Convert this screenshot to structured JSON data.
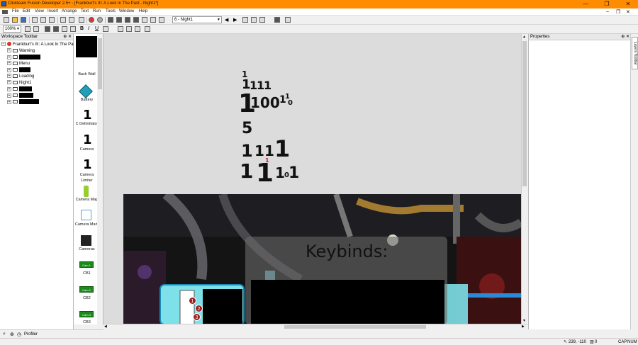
{
  "window": {
    "title": "Clickteam Fusion Developer 2.5+ - [Frankburt's III: A Look In The Past - Night1*]",
    "minimize": "—",
    "maximize": "❐",
    "close": "✕"
  },
  "menu": [
    "File",
    "Edit",
    "View",
    "Insert",
    "Arrange",
    "Text",
    "Run",
    "Tools",
    "Window",
    "Help"
  ],
  "toolbar": {
    "frame_select": "6 - Night1",
    "zoom": "100%"
  },
  "workspace": {
    "header": "Workspace Toolbar",
    "tree": [
      {
        "label": "Frankburt's III: A Look In The Past",
        "level": 0
      },
      {
        "label": "Warning",
        "level": 1
      },
      {
        "label": "",
        "level": 1,
        "redacted": true
      },
      {
        "label": "Menu",
        "level": 1
      },
      {
        "label": "",
        "level": 1,
        "redacted": true
      },
      {
        "label": "Loading",
        "level": 1
      },
      {
        "label": "Night1",
        "level": 1
      },
      {
        "label": "",
        "level": 1,
        "redacted": true
      },
      {
        "label": "",
        "level": 1,
        "redacted": true
      },
      {
        "label": "",
        "level": 1,
        "redacted": true
      }
    ]
  },
  "objects": [
    {
      "label": "Back Wall",
      "icon": "black-square-icon"
    },
    {
      "label": "Battery",
      "icon": "diamond-icon"
    },
    {
      "label": "C Delimitator",
      "icon": "one-counter-icon"
    },
    {
      "label": "Camera",
      "icon": "one-counter-icon"
    },
    {
      "label": "Camera Limiter",
      "icon": "one-counter-icon"
    },
    {
      "label": "Camera Map",
      "icon": "bottle-icon"
    },
    {
      "label": "Camera Mark",
      "icon": "white-square-icon"
    },
    {
      "label": "Cameras",
      "icon": "dark-square-icon"
    },
    {
      "label": "CB1",
      "icon": "cam-button-icon",
      "badge": "Cam 1"
    },
    {
      "label": "CB2",
      "icon": "cam-button-icon",
      "badge": "Cam 2"
    },
    {
      "label": "CB3",
      "icon": "cam-button-icon",
      "badge": "Cam 3"
    }
  ],
  "canvas": {
    "counters": [
      "1",
      "1",
      "1",
      "1",
      "1",
      "1",
      "100",
      "1",
      "1",
      "0",
      "5",
      "1",
      "1",
      "1",
      "1",
      "1",
      "1",
      "1",
      "1",
      "0",
      "1"
    ],
    "keybinds_title": "Keybinds:",
    "map_markers": [
      "1",
      "2",
      "3"
    ]
  },
  "properties": {
    "header": "Properties"
  },
  "layers_toolbar": "Layers Toolbar",
  "bottom": {
    "profiler": "Profiler"
  },
  "status": {
    "coords": "239, -110",
    "count": "0",
    "caps": "CAP",
    "num": "NUM"
  },
  "colors": {
    "titlebar": "#ff8c00",
    "canvas_bg": "#dcdcdc"
  }
}
